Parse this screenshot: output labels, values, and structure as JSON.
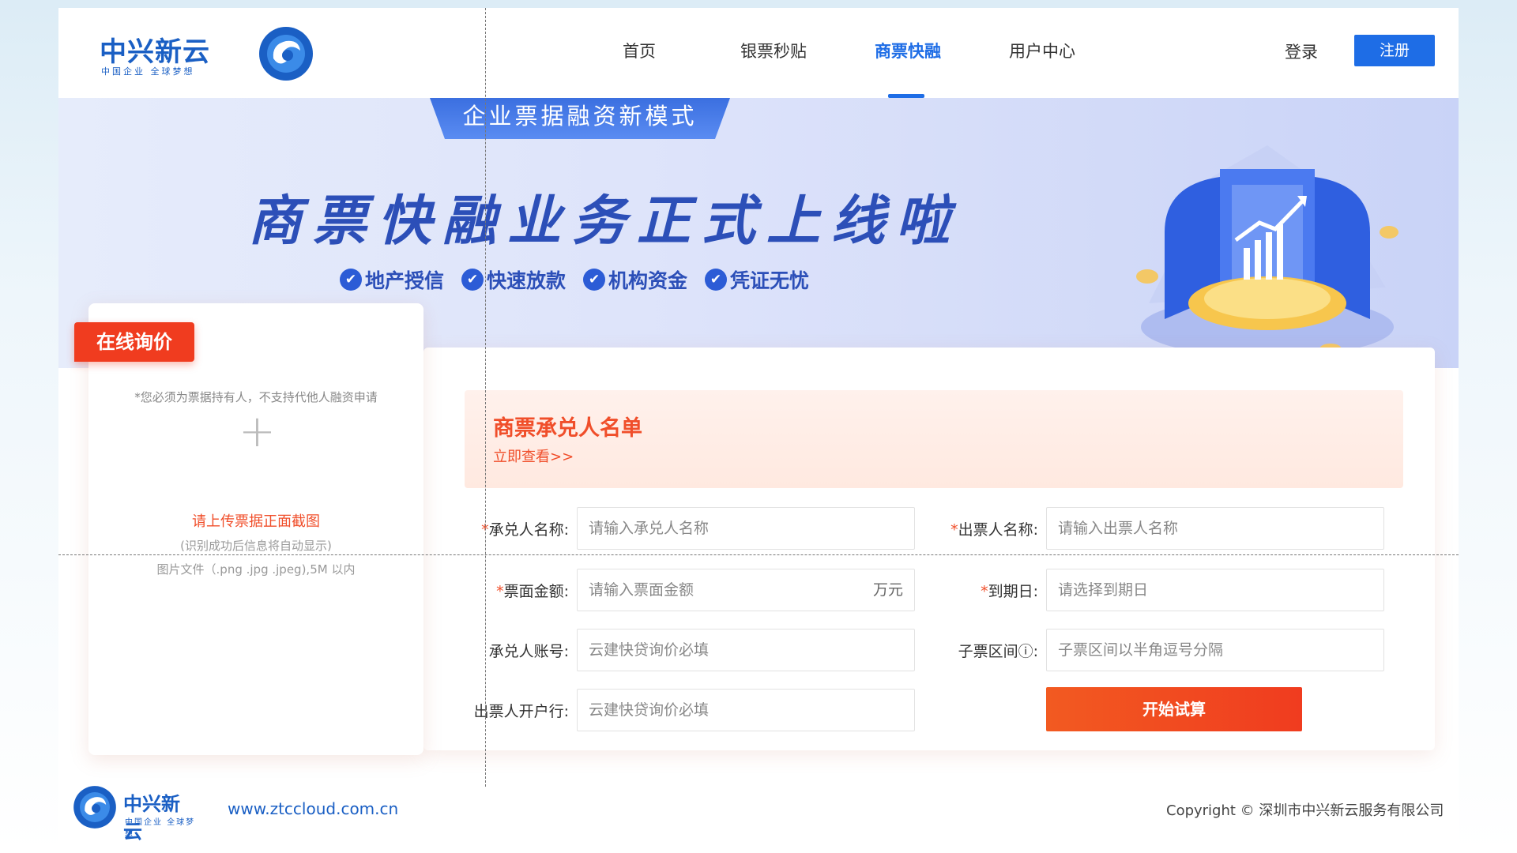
{
  "header": {
    "logo_cn": "中兴新云",
    "logo_sub": "中国企业 全球梦想",
    "nav": [
      {
        "label": "首页"
      },
      {
        "label": "银票秒贴"
      },
      {
        "label": "商票快融"
      },
      {
        "label": "用户中心"
      }
    ],
    "active_nav_index": 2,
    "login_label": "登录",
    "register_label": "注册"
  },
  "banner": {
    "tag": "企业票据融资新模式",
    "title": "商票快融业务正式上线啦",
    "features": [
      "地产授信",
      "快速放款",
      "机构资金",
      "凭证无忧"
    ]
  },
  "inquiry": {
    "tab_label": "在线询价",
    "note": "*您必须为票据持有人，不支持代他人融资申请",
    "upload_title": "请上传票据正面截图",
    "upload_sub": "(识别成功后信息将自动显示)",
    "upload_types": "图片文件（.png .jpg .jpeg),5M 以内"
  },
  "acceptor_list": {
    "title": "商票承兑人名单",
    "link": "立即查看>>"
  },
  "form": {
    "acceptor_name": {
      "label": "承兑人名称:",
      "required": "*",
      "placeholder": "请输入承兑人名称"
    },
    "drawer_name": {
      "label": "出票人名称:",
      "required": "*",
      "placeholder": "请输入出票人名称"
    },
    "face_amount": {
      "label": "票面金额:",
      "required": "*",
      "placeholder": "请输入票面金额",
      "suffix": "万元"
    },
    "due_date": {
      "label": "到期日:",
      "required": "*",
      "placeholder": "请选择到期日"
    },
    "acceptor_account": {
      "label": "承兑人账号:",
      "placeholder": "云建快贷询价必填"
    },
    "sub_ticket_range": {
      "label": "子票区间ⓘ:",
      "placeholder": "子票区间以半角逗号分隔"
    },
    "drawer_bank": {
      "label": "出票人开户行:",
      "placeholder": "云建快贷询价必填"
    },
    "submit_label": "开始试算"
  },
  "footer": {
    "logo_cn": "中兴新云",
    "logo_sub": "中国企业 全球梦想",
    "url": "www.ztccloud.com.cn",
    "copyright": "Copyright © 深圳市中兴新云服务有限公司"
  },
  "colors": {
    "brand_blue": "#1e6de6",
    "accent_red": "#f03c1f"
  }
}
